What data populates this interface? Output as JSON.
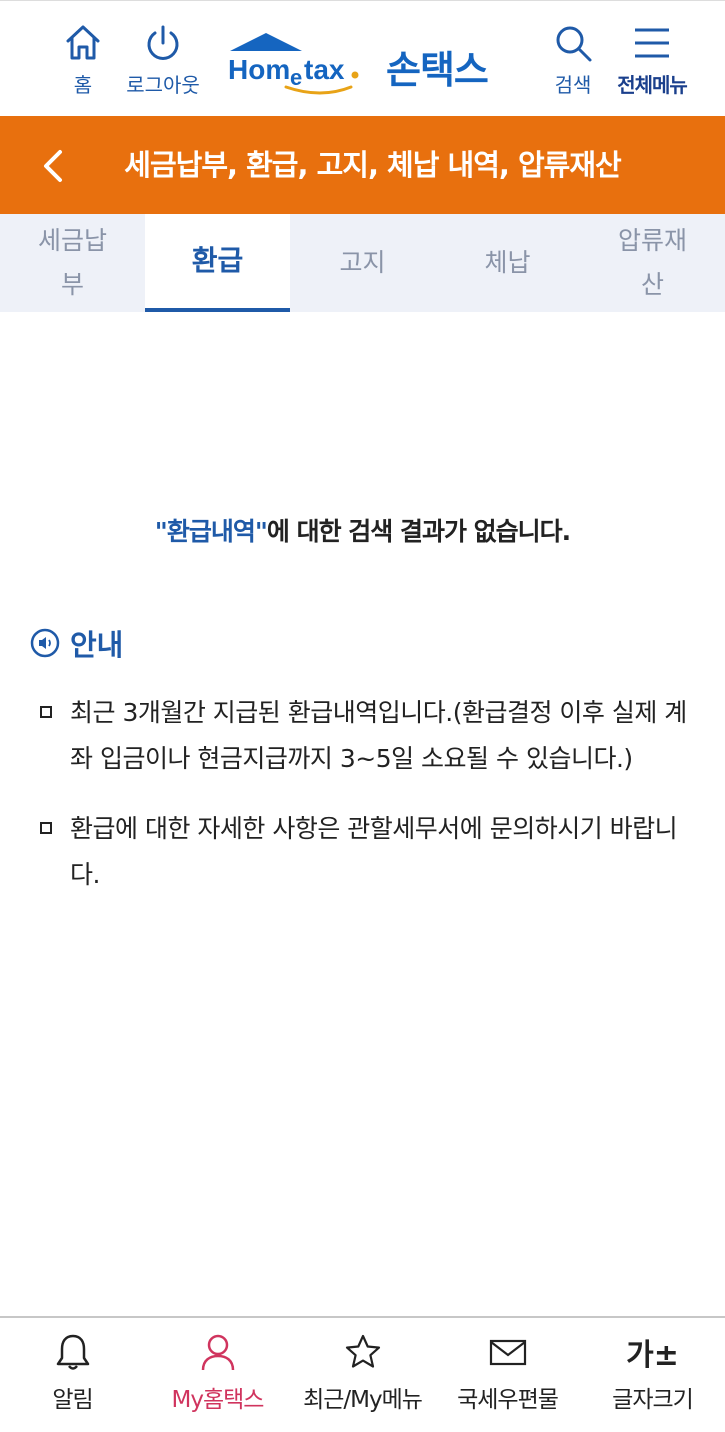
{
  "header": {
    "home_label": "홈",
    "logout_label": "로그아웃",
    "logo_text": "Hometax.",
    "logo_sub": "손택스",
    "search_label": "검색",
    "menu_label": "전체메뉴"
  },
  "titlebar": {
    "title": "세금납부, 환급, 고지, 체납 내역, 압류재산"
  },
  "tabs": [
    {
      "label": "세금납부",
      "active": false
    },
    {
      "label": "환급",
      "active": true
    },
    {
      "label": "고지",
      "active": false
    },
    {
      "label": "체납",
      "active": false
    },
    {
      "label": "압류재산",
      "active": false
    }
  ],
  "result": {
    "keyword": "\"환급내역\"",
    "message": "에 대한 검색 결과가 없습니다."
  },
  "guide": {
    "title": "안내",
    "items": [
      "최근 3개월간 지급된 환급내역입니다.(환급결정 이후 실제 계좌 입금이나 현금지급까지 3~5일 소요될 수 있습니다.)",
      "환급에 대한 자세한 사항은 관할세무서에 문의하시기 바랍니다."
    ]
  },
  "bottom_nav": [
    {
      "label": "알림",
      "icon": "bell-icon"
    },
    {
      "label": "My홈택스",
      "icon": "user-icon",
      "active": true
    },
    {
      "label": "최근/My메뉴",
      "icon": "star-icon"
    },
    {
      "label": "국세우편물",
      "icon": "mail-icon"
    },
    {
      "label": "글자크기",
      "icon": "font-size-icon",
      "glyph": "가±"
    }
  ],
  "colors": {
    "accent_blue": "#1f5aa8",
    "title_orange": "#e8700e",
    "active_nav": "#d0345e"
  }
}
